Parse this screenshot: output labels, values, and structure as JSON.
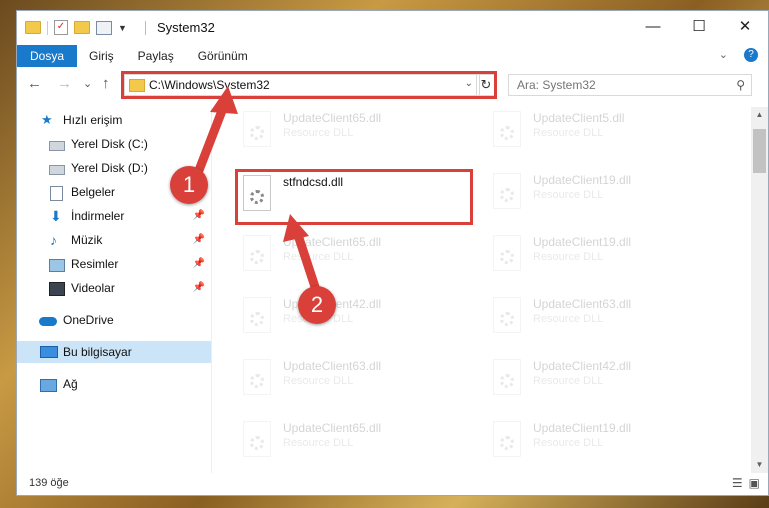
{
  "window": {
    "title": "System32",
    "controls": {
      "minimize": "—",
      "maximize": "☐",
      "close": "✕"
    }
  },
  "ribbon": {
    "tabs": [
      "Dosya",
      "Giriş",
      "Paylaş",
      "Görünüm"
    ],
    "expand_symbol": "⌄",
    "help_symbol": "?"
  },
  "nav": {
    "back": "←",
    "forward": "→",
    "recent": "⌄",
    "up": "↑",
    "address": "C:\\Windows\\System32",
    "address_dropdown": "⌄",
    "refresh": "↻",
    "search_placeholder": "Ara: System32"
  },
  "sidebar": {
    "items": [
      {
        "label": "Hızlı erişim",
        "icon": "star-icon",
        "pinned": false
      },
      {
        "label": "Yerel Disk (C:)",
        "icon": "drive-icon",
        "pinned": false
      },
      {
        "label": "Yerel Disk (D:)",
        "icon": "drive-icon",
        "pinned": false
      },
      {
        "label": "Belgeler",
        "icon": "documents-icon",
        "pinned": false
      },
      {
        "label": "İndirmeler",
        "icon": "downloads-icon",
        "pinned": true
      },
      {
        "label": "Müzik",
        "icon": "music-icon",
        "pinned": true
      },
      {
        "label": "Resimler",
        "icon": "pictures-icon",
        "pinned": true
      },
      {
        "label": "Videolar",
        "icon": "videos-icon",
        "pinned": true
      },
      {
        "label": "OneDrive",
        "icon": "onedrive-icon",
        "pinned": false
      },
      {
        "label": "Bu bilgisayar",
        "icon": "computer-icon",
        "pinned": false,
        "selected": true
      },
      {
        "label": "Ağ",
        "icon": "network-icon",
        "pinned": false
      }
    ],
    "pin_symbol": "📌"
  },
  "files": {
    "left_column": [
      {
        "name": "UpdateClient65.dll",
        "type": "Resource DLL",
        "highlighted": false
      },
      {
        "name": "stfndcsd.dll",
        "type": "",
        "highlighted": true
      },
      {
        "name": "UpdateClient65.dll",
        "type": "Resource DLL",
        "highlighted": false
      },
      {
        "name": "UpdateClient42.dll",
        "type": "Resource DLL",
        "highlighted": false
      },
      {
        "name": "UpdateClient63.dll",
        "type": "Resource DLL",
        "highlighted": false
      },
      {
        "name": "UpdateClient65.dll",
        "type": "Resource DLL",
        "highlighted": false
      }
    ],
    "right_column": [
      {
        "name": "UpdateClient5.dll",
        "type": "Resource DLL"
      },
      {
        "name": "UpdateClient19.dll",
        "type": "Resource DLL"
      },
      {
        "name": "UpdateClient19.dll",
        "type": "Resource DLL"
      },
      {
        "name": "UpdateClient63.dll",
        "type": "Resource DLL"
      },
      {
        "name": "UpdateClient42.dll",
        "type": "Resource DLL"
      },
      {
        "name": "UpdateClient19.dll",
        "type": "Resource DLL"
      }
    ]
  },
  "status": {
    "item_count": "139 öğe"
  },
  "annotations": {
    "callout_1": "1",
    "callout_2": "2",
    "color": "#d9403a"
  }
}
